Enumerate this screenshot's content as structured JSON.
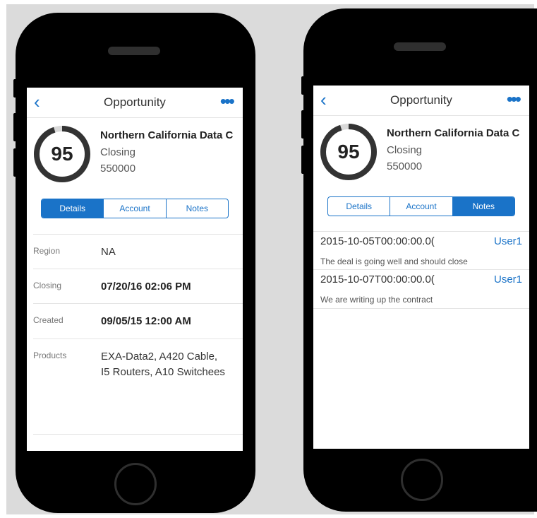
{
  "left_phone": {
    "header": {
      "back_icon": "chevron-left-icon",
      "title": "Opportunity",
      "more_icon": "ellipsis-icon"
    },
    "summary": {
      "score": "95",
      "score_fraction": 0.95,
      "name": "Northern California Data C",
      "stage": "Closing",
      "amount": "550000"
    },
    "tabs": [
      {
        "label": "Details",
        "active": true
      },
      {
        "label": "Account",
        "active": false
      },
      {
        "label": "Notes",
        "active": false
      }
    ],
    "details": [
      {
        "label": "Region",
        "value": "NA"
      },
      {
        "label": "Closing",
        "value": "07/20/16 02:06 PM"
      },
      {
        "label": "Created",
        "value": "09/05/15 12:00 AM"
      },
      {
        "label": "Products",
        "value_line1": "EXA-Data2, A420 Cable,",
        "value_line2": "I5 Routers, A10 Switchees"
      }
    ]
  },
  "right_phone": {
    "header": {
      "back_icon": "chevron-left-icon",
      "title": "Opportunity",
      "more_icon": "ellipsis-icon"
    },
    "summary": {
      "score": "95",
      "score_fraction": 0.95,
      "name": "Northern California Data C",
      "stage": "Closing",
      "amount": "550000"
    },
    "tabs": [
      {
        "label": "Details",
        "active": false
      },
      {
        "label": "Account",
        "active": false
      },
      {
        "label": "Notes",
        "active": true
      }
    ],
    "notes": [
      {
        "date": "2015-10-05T00:00:00.0(",
        "user": "User1",
        "text": "The deal is going well and should close"
      },
      {
        "date": "2015-10-07T00:00:00.0(",
        "user": "User1",
        "text": "We are writing up the contract"
      }
    ]
  },
  "colors": {
    "accent": "#1a73c8",
    "ring": "#333333",
    "ring_gap": "#d9d9d9",
    "phone_body": "#000000",
    "backdrop": "#dbdbdb"
  }
}
